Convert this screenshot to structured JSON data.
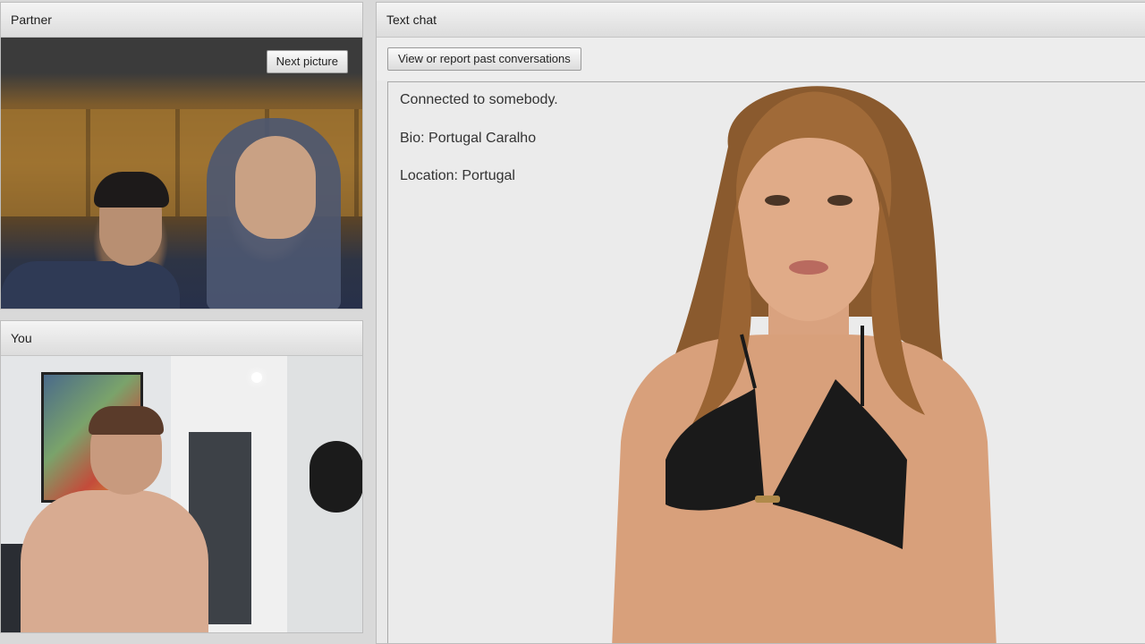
{
  "partner": {
    "header": "Partner",
    "next_picture_label": "Next picture"
  },
  "you": {
    "header": "You"
  },
  "chat": {
    "header": "Text chat",
    "report_button_label": "View or report past conversations",
    "messages": [
      "Connected to somebody.",
      "Bio: Portugal Caralho",
      "Location: Portugal"
    ]
  },
  "colors": {
    "panel_bg": "#e9e9e9",
    "header_bg": "#dcdcdc",
    "chat_bg": "#ebebeb",
    "text": "#333333"
  }
}
